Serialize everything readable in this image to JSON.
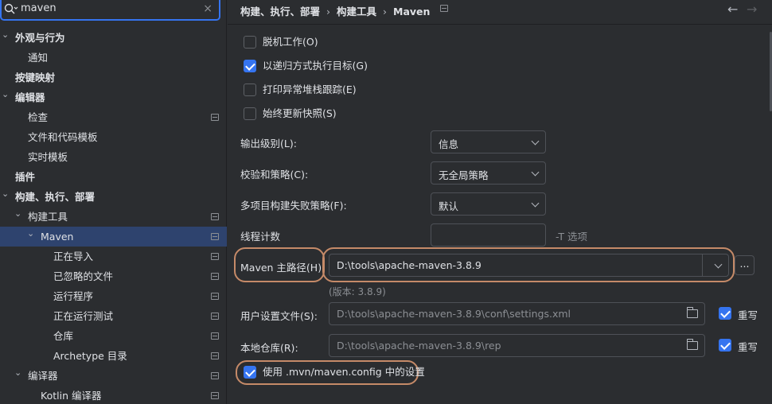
{
  "search": {
    "value": "maven",
    "clear_icon": "×"
  },
  "tree": [
    {
      "label": "外观与行为",
      "depth": 0,
      "arrow": "⌄",
      "bold": true,
      "pin": false
    },
    {
      "label": "通知",
      "depth": 1,
      "arrow": "",
      "bold": false,
      "pin": false
    },
    {
      "label": "按键映射",
      "depth": 0,
      "arrow": "",
      "bold": true,
      "pin": false
    },
    {
      "label": "编辑器",
      "depth": 0,
      "arrow": "⌄",
      "bold": true,
      "pin": false
    },
    {
      "label": "检查",
      "depth": 1,
      "arrow": "",
      "bold": false,
      "pin": true
    },
    {
      "label": "文件和代码模板",
      "depth": 1,
      "arrow": "",
      "bold": false,
      "pin": false
    },
    {
      "label": "实时模板",
      "depth": 1,
      "arrow": "",
      "bold": false,
      "pin": false
    },
    {
      "label": "插件",
      "depth": 0,
      "arrow": "",
      "bold": true,
      "pin": false
    },
    {
      "label": "构建、执行、部署",
      "depth": 0,
      "arrow": "⌄",
      "bold": true,
      "pin": false
    },
    {
      "label": "构建工具",
      "depth": 1,
      "arrow": "⌄",
      "bold": false,
      "pin": true
    },
    {
      "label": "Maven",
      "depth": 2,
      "arrow": "⌄",
      "bold": false,
      "pin": true,
      "selected": true
    },
    {
      "label": "正在导入",
      "depth": 3,
      "arrow": "",
      "bold": false,
      "pin": true
    },
    {
      "label": "已忽略的文件",
      "depth": 3,
      "arrow": "",
      "bold": false,
      "pin": true
    },
    {
      "label": "运行程序",
      "depth": 3,
      "arrow": "",
      "bold": false,
      "pin": true
    },
    {
      "label": "正在运行测试",
      "depth": 3,
      "arrow": "",
      "bold": false,
      "pin": true
    },
    {
      "label": "仓库",
      "depth": 3,
      "arrow": "",
      "bold": false,
      "pin": true
    },
    {
      "label": "Archetype 目录",
      "depth": 3,
      "arrow": "",
      "bold": false,
      "pin": true
    },
    {
      "label": "编译器",
      "depth": 1,
      "arrow": "⌄",
      "bold": false,
      "pin": true
    },
    {
      "label": "Kotlin 编译器",
      "depth": 2,
      "arrow": "",
      "bold": false,
      "pin": true
    }
  ],
  "breadcrumb": {
    "items": [
      "构建、执行、部署",
      "构建工具",
      "Maven"
    ],
    "sep": "›"
  },
  "nav": {
    "back": "←",
    "forward": "→"
  },
  "checkboxes": [
    {
      "label": "脱机工作(O)",
      "checked": false
    },
    {
      "label": "以递归方式执行目标(G)",
      "checked": true
    },
    {
      "label": "打印异常堆栈跟踪(E)",
      "checked": false
    },
    {
      "label": "始终更新快照(S)",
      "checked": false
    }
  ],
  "fields": {
    "output_level": {
      "label": "输出级别(L):",
      "value": "信息"
    },
    "checksum": {
      "label": "校验和策略(C):",
      "value": "无全局策略"
    },
    "multiproject": {
      "label": "多项目构建失败策略(F):",
      "value": "默认"
    },
    "threads": {
      "label": "线程计数",
      "value": "",
      "suffix": "-T 选项"
    },
    "maven_home": {
      "label": "Maven 主路径(H):",
      "value": "D:\\tools\\apache-maven-3.8.9",
      "version": "(版本: 3.8.9)",
      "browse": "..."
    },
    "user_settings": {
      "label": "用户设置文件(S):",
      "value": "D:\\tools\\apache-maven-3.8.9\\conf\\settings.xml",
      "override": "重写",
      "override_checked": true
    },
    "local_repo": {
      "label": "本地仓库(R):",
      "value": "D:\\tools\\apache-maven-3.8.9\\rep",
      "override": "重写",
      "override_checked": true
    }
  },
  "mvn_config": {
    "label": "使用 .mvn/maven.config 中的设置",
    "checked": true
  }
}
